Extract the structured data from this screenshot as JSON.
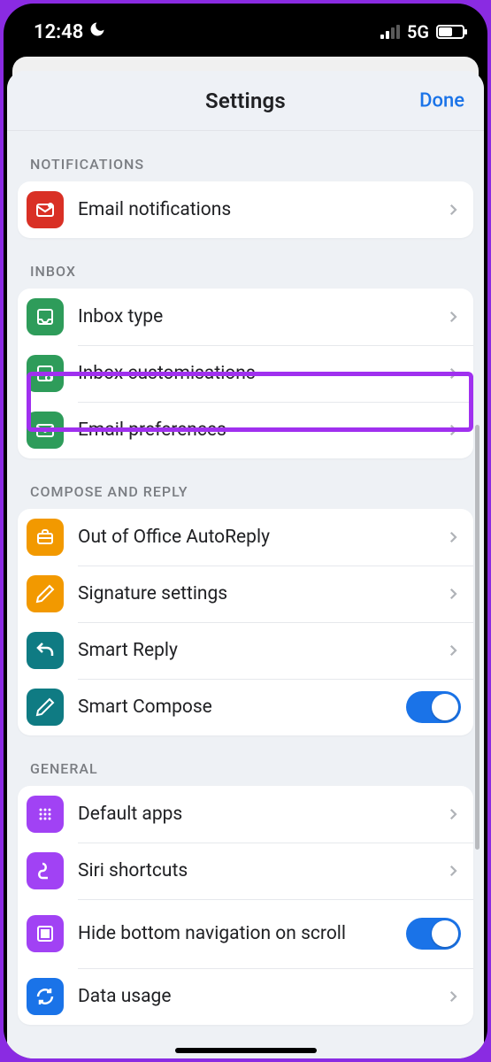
{
  "statusbar": {
    "time": "12:48",
    "network": "5G"
  },
  "sheet": {
    "title": "Settings",
    "done_label": "Done"
  },
  "sections": {
    "notifications": {
      "header": "NOTIFICATIONS",
      "email_notifications": "Email notifications"
    },
    "inbox": {
      "header": "INBOX",
      "inbox_type": "Inbox type",
      "inbox_customisations": "Inbox customisations",
      "email_preferences": "Email preferences"
    },
    "compose": {
      "header": "COMPOSE AND REPLY",
      "out_of_office": "Out of Office AutoReply",
      "signature": "Signature settings",
      "smart_reply": "Smart Reply",
      "smart_compose": "Smart Compose"
    },
    "general": {
      "header": "GENERAL",
      "default_apps": "Default apps",
      "siri_shortcuts": "Siri shortcuts",
      "hide_bottom_nav": "Hide bottom navigation on scroll",
      "data_usage": "Data usage"
    }
  },
  "toggles": {
    "smart_compose": true,
    "hide_bottom_nav": true
  },
  "colors": {
    "accent": "#1a73e8",
    "highlight": "#a030ef"
  }
}
